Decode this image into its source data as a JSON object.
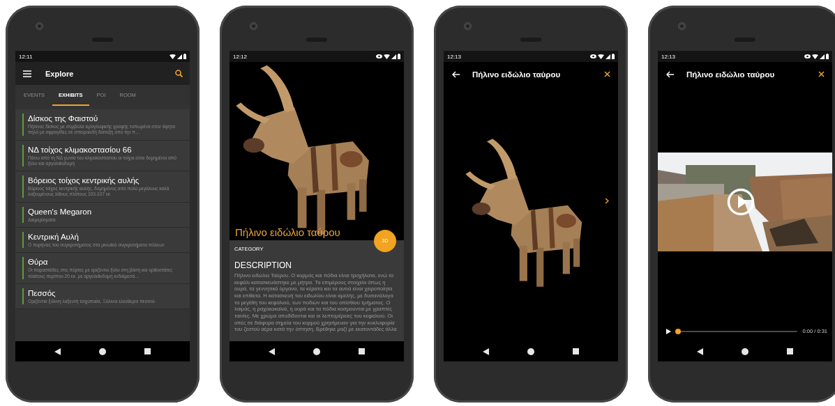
{
  "phones": [
    {
      "kind": "explore",
      "status_time": "12:11",
      "eye_indicator": false,
      "title": "Explore",
      "tabs": [
        {
          "label": "EVENTS",
          "selected": false
        },
        {
          "label": "EXHIBITS",
          "selected": true
        },
        {
          "label": "POI",
          "selected": false
        },
        {
          "label": "ROOM",
          "selected": false
        }
      ],
      "items": [
        {
          "title": "Δίσκος της Φαιστού",
          "description": "Πήλινος δίσκος με σύμβολα ιερογλυφικής γραφής τυπωμένα στον άψητο πηλό με σφραγίδες σε σπειροειδή διάταξη από την π…"
        },
        {
          "title": "ΝΔ τοίχος κλιμακοστασίου 66",
          "description": "Πάνω από τη ΝΔ γωνία του κλιμακοστασίου οι τοίχοι είναι δομημένοι από ξύλο και αργολιθοδομή"
        },
        {
          "title": "Βόρειος τοίχος κεντρικής αυλής",
          "description": "Βόρειος τοίχος κεντρικής αυλής, δομημένος από πολύ μεγάλους καλά λαξευμένους λίθους πλάτους 103-107 εκ"
        },
        {
          "title": "Queen's Megaron",
          "description": "Διαμερίσματα"
        },
        {
          "title": "Κεντρική Αυλή",
          "description": "Ο πυρήνας του συγκροτήματος στα μινωϊκά συγκροτήματα πόλεων"
        },
        {
          "title": "Θύρα",
          "description": "Οι παραστάδες στις πόρτες με οριζόντιο ξύλο στη βάση και ορθοστάτες πλάτους περίπου 20 εκ. με αργολιθοδομή ενδιάμεσά…"
        },
        {
          "title": "Πεσσός",
          "description": "Οριζόντια ξύλινη λαξευτή τοιχοποιία, Ξύλινοι ελεύθεροι πεσσοί-"
        }
      ]
    },
    {
      "kind": "detail",
      "status_time": "12:12",
      "eye_indicator": true,
      "title": "Πήλινο ειδώλιο ταύρου",
      "fab_label": "3D",
      "category": "CATEGORY",
      "description_heading": "DESCRIPTION",
      "description": "Πήλινο ειδώλιο Ταύρου. Ο κορμός και πόδια είναι τροχήλατα, ενώ το κεφάλι κατασκευάστηκε με μήτρα. Τα επιμέρους στοιχεία όπως η ουρά, τα γεννητικά όργανα, τα κέρατα και τα αυτιά είναι χειροποίητα και επίθετα. Η κατασκευή του ειδωλίου είναι αμελής, με δυσανάλογα τα μεγέθη του κεφαλιού, των ποδιών και του οπίσθιου τμήματος. Ο λαιμός, η ραχοκοκαλιά, η ουρά και τα πόδια κοσμούνται με γραπτές ταινίες. Με χρώμα αποδίδονται και οι λεπτομέρειες του κεφαλιού. Οι οπές σε διάφορα σημεία του κορμού χρησίμευαν για την κυκλοφορία του ζεστού αέρα κατά την όπτηση. Βρέθηκε μαζί με εκατοντάδες άλλα"
    },
    {
      "kind": "viewer",
      "status_time": "12:13",
      "eye_indicator": true,
      "title": "Πήλινο ειδώλιο ταύρου"
    },
    {
      "kind": "video",
      "status_time": "12:13",
      "eye_indicator": true,
      "title": "Πήλινο ειδώλιο ταύρου",
      "level": 0,
      "time": "0:00 / 0:31"
    }
  ]
}
